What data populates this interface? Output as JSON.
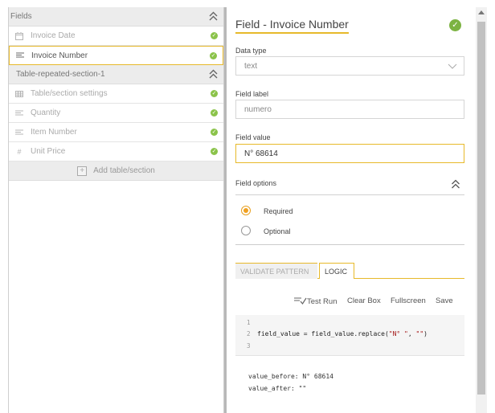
{
  "left_panel": {
    "fields_header": "Fields",
    "fields": [
      {
        "label": "Invoice Date",
        "icon": "calendar-icon",
        "active": false
      },
      {
        "label": "Invoice Number",
        "icon": "text-lines-icon",
        "active": true
      }
    ],
    "section_header": "Table-repeated-section-1",
    "section_fields": [
      {
        "label": "Table/section settings",
        "icon": "table-icon"
      },
      {
        "label": "Quantity",
        "icon": "text-lines-icon"
      },
      {
        "label": "Item Number",
        "icon": "text-lines-icon"
      },
      {
        "label": "Unit Price",
        "icon": "hash-icon"
      }
    ],
    "add_label": "Add table/section"
  },
  "editor": {
    "title": "Field - Invoice Number",
    "data_type_label": "Data type",
    "data_type_value": "text",
    "field_label_label": "Field label",
    "field_label_value": "numero",
    "field_value_label": "Field value",
    "field_value_value": "N° 68614",
    "field_options_label": "Field options",
    "options": [
      {
        "label": "Required",
        "selected": true
      },
      {
        "label": "Optional",
        "selected": false
      }
    ],
    "tabs": {
      "validate": "VALIDATE PATTERN",
      "logic": "LOGIC"
    },
    "toolbar": {
      "test_run": "Test Run",
      "clear_box": "Clear Box",
      "fullscreen": "Fullscreen",
      "save": "Save"
    },
    "code": {
      "lines": [
        "1",
        "2",
        "3"
      ],
      "line2_pre": "field_value = field_value.replace(",
      "line2_str1": "\"N° \"",
      "line2_sep": ", ",
      "line2_str2": "\"\"",
      "line2_post": ")"
    },
    "output": [
      "value_before: N° 68614",
      "value_after: \"\""
    ]
  },
  "colors": {
    "accent": "#e7b92a",
    "success": "#8bc34a",
    "radio": "#f0a020"
  }
}
